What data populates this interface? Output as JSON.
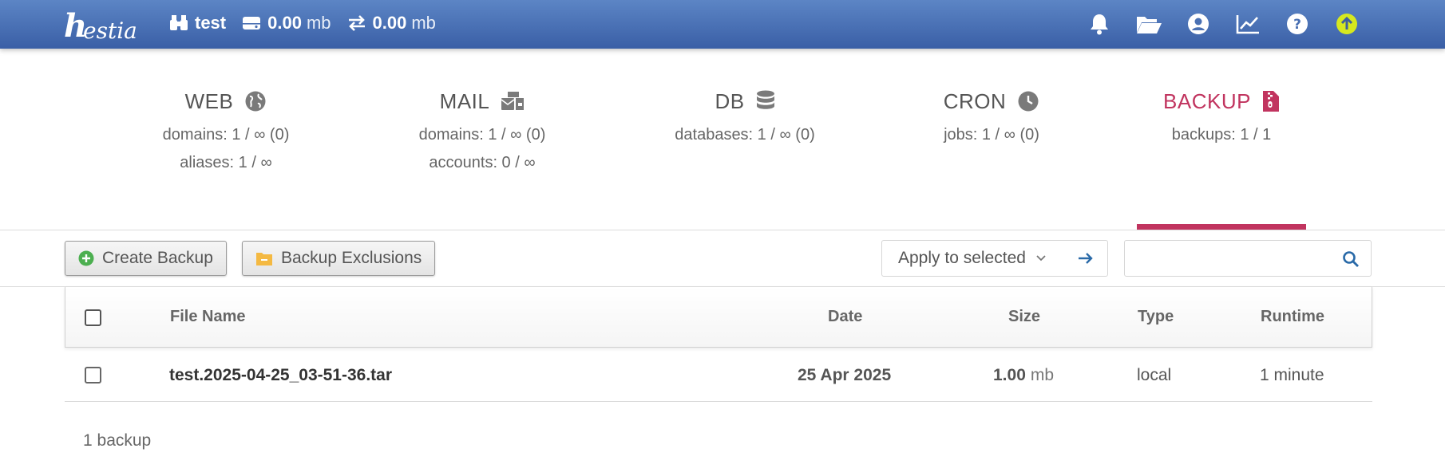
{
  "topbar": {
    "user": "test",
    "disk_value": "0.00",
    "disk_unit": "mb",
    "bandwidth_value": "0.00",
    "bandwidth_unit": "mb"
  },
  "sections": [
    {
      "title": "WEB",
      "lines": [
        "domains: 1 / ∞ (0)",
        "aliases: 1 / ∞"
      ],
      "icon": "globe-icon"
    },
    {
      "title": "MAIL",
      "lines": [
        "domains: 1 / ∞ (0)",
        "accounts: 0 / ∞"
      ],
      "icon": "mail-bulk-icon"
    },
    {
      "title": "DB",
      "lines": [
        "databases: 1 / ∞ (0)"
      ],
      "icon": "database-icon"
    },
    {
      "title": "CRON",
      "lines": [
        "jobs: 1 / ∞ (0)"
      ],
      "icon": "clock-icon"
    },
    {
      "title": "BACKUP",
      "lines": [
        "backups: 1 / 1"
      ],
      "icon": "file-zipper-icon",
      "active": true
    }
  ],
  "toolbar": {
    "create_label": "Create Backup",
    "exclusions_label": "Backup Exclusions",
    "apply_label": "Apply to selected",
    "search_placeholder": ""
  },
  "table": {
    "headers": {
      "file_name": "File Name",
      "date": "Date",
      "size": "Size",
      "type": "Type",
      "runtime": "Runtime"
    },
    "rows": [
      {
        "file_name": "test.2025-04-25_03-51-36.tar",
        "date": "25 Apr 2025",
        "size": "1.00",
        "size_unit": "mb",
        "type": "local",
        "runtime": "1 minute"
      }
    ]
  },
  "footer": {
    "count": "1 backup"
  },
  "colors": {
    "accent": "#c1345f",
    "topbar": "#4a70b3",
    "update": "#d6e81f"
  }
}
